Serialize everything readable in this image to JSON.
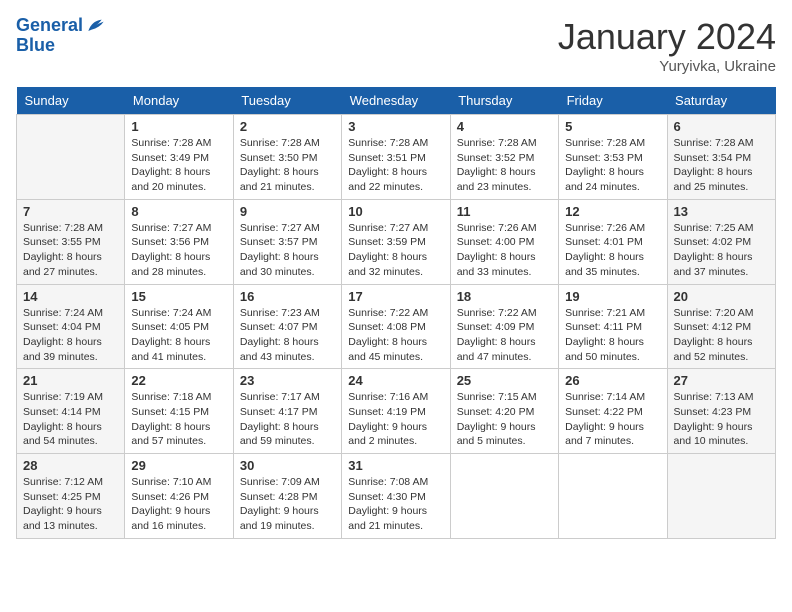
{
  "header": {
    "logo_line1": "General",
    "logo_line2": "Blue",
    "title": "January 2024",
    "subtitle": "Yuryivka, Ukraine"
  },
  "days_of_week": [
    "Sunday",
    "Monday",
    "Tuesday",
    "Wednesday",
    "Thursday",
    "Friday",
    "Saturday"
  ],
  "weeks": [
    [
      {
        "day": "",
        "sunrise": "",
        "sunset": "",
        "daylight": ""
      },
      {
        "day": "1",
        "sunrise": "Sunrise: 7:28 AM",
        "sunset": "Sunset: 3:49 PM",
        "daylight": "Daylight: 8 hours and 20 minutes."
      },
      {
        "day": "2",
        "sunrise": "Sunrise: 7:28 AM",
        "sunset": "Sunset: 3:50 PM",
        "daylight": "Daylight: 8 hours and 21 minutes."
      },
      {
        "day": "3",
        "sunrise": "Sunrise: 7:28 AM",
        "sunset": "Sunset: 3:51 PM",
        "daylight": "Daylight: 8 hours and 22 minutes."
      },
      {
        "day": "4",
        "sunrise": "Sunrise: 7:28 AM",
        "sunset": "Sunset: 3:52 PM",
        "daylight": "Daylight: 8 hours and 23 minutes."
      },
      {
        "day": "5",
        "sunrise": "Sunrise: 7:28 AM",
        "sunset": "Sunset: 3:53 PM",
        "daylight": "Daylight: 8 hours and 24 minutes."
      },
      {
        "day": "6",
        "sunrise": "Sunrise: 7:28 AM",
        "sunset": "Sunset: 3:54 PM",
        "daylight": "Daylight: 8 hours and 25 minutes."
      }
    ],
    [
      {
        "day": "7",
        "sunrise": "Sunrise: 7:28 AM",
        "sunset": "Sunset: 3:55 PM",
        "daylight": "Daylight: 8 hours and 27 minutes."
      },
      {
        "day": "8",
        "sunrise": "Sunrise: 7:27 AM",
        "sunset": "Sunset: 3:56 PM",
        "daylight": "Daylight: 8 hours and 28 minutes."
      },
      {
        "day": "9",
        "sunrise": "Sunrise: 7:27 AM",
        "sunset": "Sunset: 3:57 PM",
        "daylight": "Daylight: 8 hours and 30 minutes."
      },
      {
        "day": "10",
        "sunrise": "Sunrise: 7:27 AM",
        "sunset": "Sunset: 3:59 PM",
        "daylight": "Daylight: 8 hours and 32 minutes."
      },
      {
        "day": "11",
        "sunrise": "Sunrise: 7:26 AM",
        "sunset": "Sunset: 4:00 PM",
        "daylight": "Daylight: 8 hours and 33 minutes."
      },
      {
        "day": "12",
        "sunrise": "Sunrise: 7:26 AM",
        "sunset": "Sunset: 4:01 PM",
        "daylight": "Daylight: 8 hours and 35 minutes."
      },
      {
        "day": "13",
        "sunrise": "Sunrise: 7:25 AM",
        "sunset": "Sunset: 4:02 PM",
        "daylight": "Daylight: 8 hours and 37 minutes."
      }
    ],
    [
      {
        "day": "14",
        "sunrise": "Sunrise: 7:24 AM",
        "sunset": "Sunset: 4:04 PM",
        "daylight": "Daylight: 8 hours and 39 minutes."
      },
      {
        "day": "15",
        "sunrise": "Sunrise: 7:24 AM",
        "sunset": "Sunset: 4:05 PM",
        "daylight": "Daylight: 8 hours and 41 minutes."
      },
      {
        "day": "16",
        "sunrise": "Sunrise: 7:23 AM",
        "sunset": "Sunset: 4:07 PM",
        "daylight": "Daylight: 8 hours and 43 minutes."
      },
      {
        "day": "17",
        "sunrise": "Sunrise: 7:22 AM",
        "sunset": "Sunset: 4:08 PM",
        "daylight": "Daylight: 8 hours and 45 minutes."
      },
      {
        "day": "18",
        "sunrise": "Sunrise: 7:22 AM",
        "sunset": "Sunset: 4:09 PM",
        "daylight": "Daylight: 8 hours and 47 minutes."
      },
      {
        "day": "19",
        "sunrise": "Sunrise: 7:21 AM",
        "sunset": "Sunset: 4:11 PM",
        "daylight": "Daylight: 8 hours and 50 minutes."
      },
      {
        "day": "20",
        "sunrise": "Sunrise: 7:20 AM",
        "sunset": "Sunset: 4:12 PM",
        "daylight": "Daylight: 8 hours and 52 minutes."
      }
    ],
    [
      {
        "day": "21",
        "sunrise": "Sunrise: 7:19 AM",
        "sunset": "Sunset: 4:14 PM",
        "daylight": "Daylight: 8 hours and 54 minutes."
      },
      {
        "day": "22",
        "sunrise": "Sunrise: 7:18 AM",
        "sunset": "Sunset: 4:15 PM",
        "daylight": "Daylight: 8 hours and 57 minutes."
      },
      {
        "day": "23",
        "sunrise": "Sunrise: 7:17 AM",
        "sunset": "Sunset: 4:17 PM",
        "daylight": "Daylight: 8 hours and 59 minutes."
      },
      {
        "day": "24",
        "sunrise": "Sunrise: 7:16 AM",
        "sunset": "Sunset: 4:19 PM",
        "daylight": "Daylight: 9 hours and 2 minutes."
      },
      {
        "day": "25",
        "sunrise": "Sunrise: 7:15 AM",
        "sunset": "Sunset: 4:20 PM",
        "daylight": "Daylight: 9 hours and 5 minutes."
      },
      {
        "day": "26",
        "sunrise": "Sunrise: 7:14 AM",
        "sunset": "Sunset: 4:22 PM",
        "daylight": "Daylight: 9 hours and 7 minutes."
      },
      {
        "day": "27",
        "sunrise": "Sunrise: 7:13 AM",
        "sunset": "Sunset: 4:23 PM",
        "daylight": "Daylight: 9 hours and 10 minutes."
      }
    ],
    [
      {
        "day": "28",
        "sunrise": "Sunrise: 7:12 AM",
        "sunset": "Sunset: 4:25 PM",
        "daylight": "Daylight: 9 hours and 13 minutes."
      },
      {
        "day": "29",
        "sunrise": "Sunrise: 7:10 AM",
        "sunset": "Sunset: 4:26 PM",
        "daylight": "Daylight: 9 hours and 16 minutes."
      },
      {
        "day": "30",
        "sunrise": "Sunrise: 7:09 AM",
        "sunset": "Sunset: 4:28 PM",
        "daylight": "Daylight: 9 hours and 19 minutes."
      },
      {
        "day": "31",
        "sunrise": "Sunrise: 7:08 AM",
        "sunset": "Sunset: 4:30 PM",
        "daylight": "Daylight: 9 hours and 21 minutes."
      },
      {
        "day": "",
        "sunrise": "",
        "sunset": "",
        "daylight": ""
      },
      {
        "day": "",
        "sunrise": "",
        "sunset": "",
        "daylight": ""
      },
      {
        "day": "",
        "sunrise": "",
        "sunset": "",
        "daylight": ""
      }
    ]
  ]
}
